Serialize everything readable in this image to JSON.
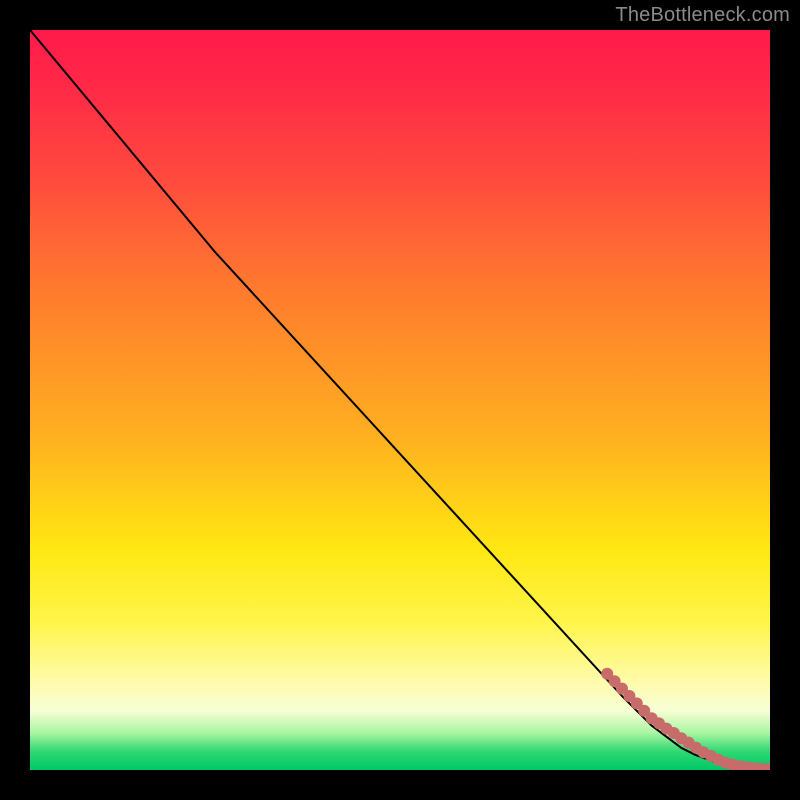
{
  "attribution": "TheBottleneck.com",
  "chart_data": {
    "type": "line",
    "title": "",
    "xlabel": "",
    "ylabel": "",
    "xlim": [
      0,
      100
    ],
    "ylim": [
      0,
      100
    ],
    "grid": false,
    "legend": false,
    "series": [
      {
        "name": "curve",
        "x": [
          0,
          25,
          80,
          82,
          84,
          86,
          88,
          90,
          92,
          93,
          94,
          95,
          97,
          100
        ],
        "y": [
          100,
          70,
          10,
          8,
          6,
          4.5,
          3,
          2,
          1.3,
          0.9,
          0.6,
          0.4,
          0.2,
          0.1
        ],
        "stroke": "#000000",
        "stroke_width": 2
      }
    ],
    "points": {
      "name": "markers",
      "x": [
        78,
        79,
        80,
        81,
        82,
        83,
        84,
        85,
        86,
        87,
        88,
        89,
        90,
        91,
        92,
        93,
        94,
        95,
        96,
        97,
        98,
        99,
        100
      ],
      "y": [
        13,
        12,
        11,
        10,
        9,
        8,
        7,
        6.3,
        5.6,
        5,
        4.3,
        3.7,
        3.0,
        2.4,
        1.9,
        1.4,
        1.0,
        0.7,
        0.5,
        0.35,
        0.25,
        0.18,
        0.12
      ],
      "color": "#c76b6b",
      "radius_px": 6
    }
  }
}
